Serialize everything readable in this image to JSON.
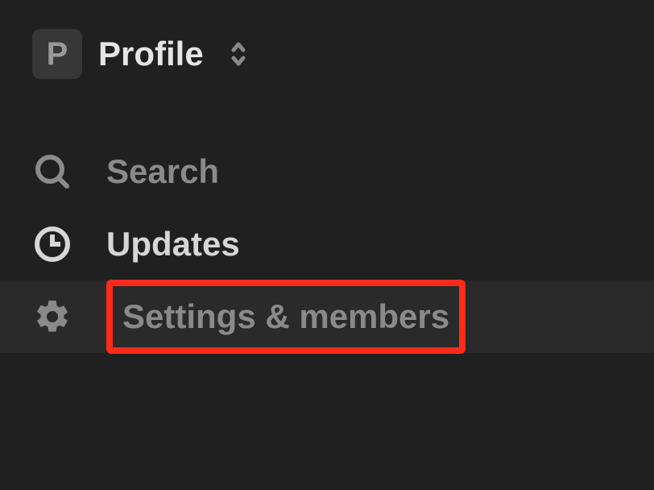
{
  "workspace": {
    "avatar_letter": "P",
    "name": "Profile"
  },
  "nav": {
    "search": {
      "label": "Search"
    },
    "updates": {
      "label": "Updates"
    },
    "settings": {
      "label": "Settings & members"
    }
  }
}
